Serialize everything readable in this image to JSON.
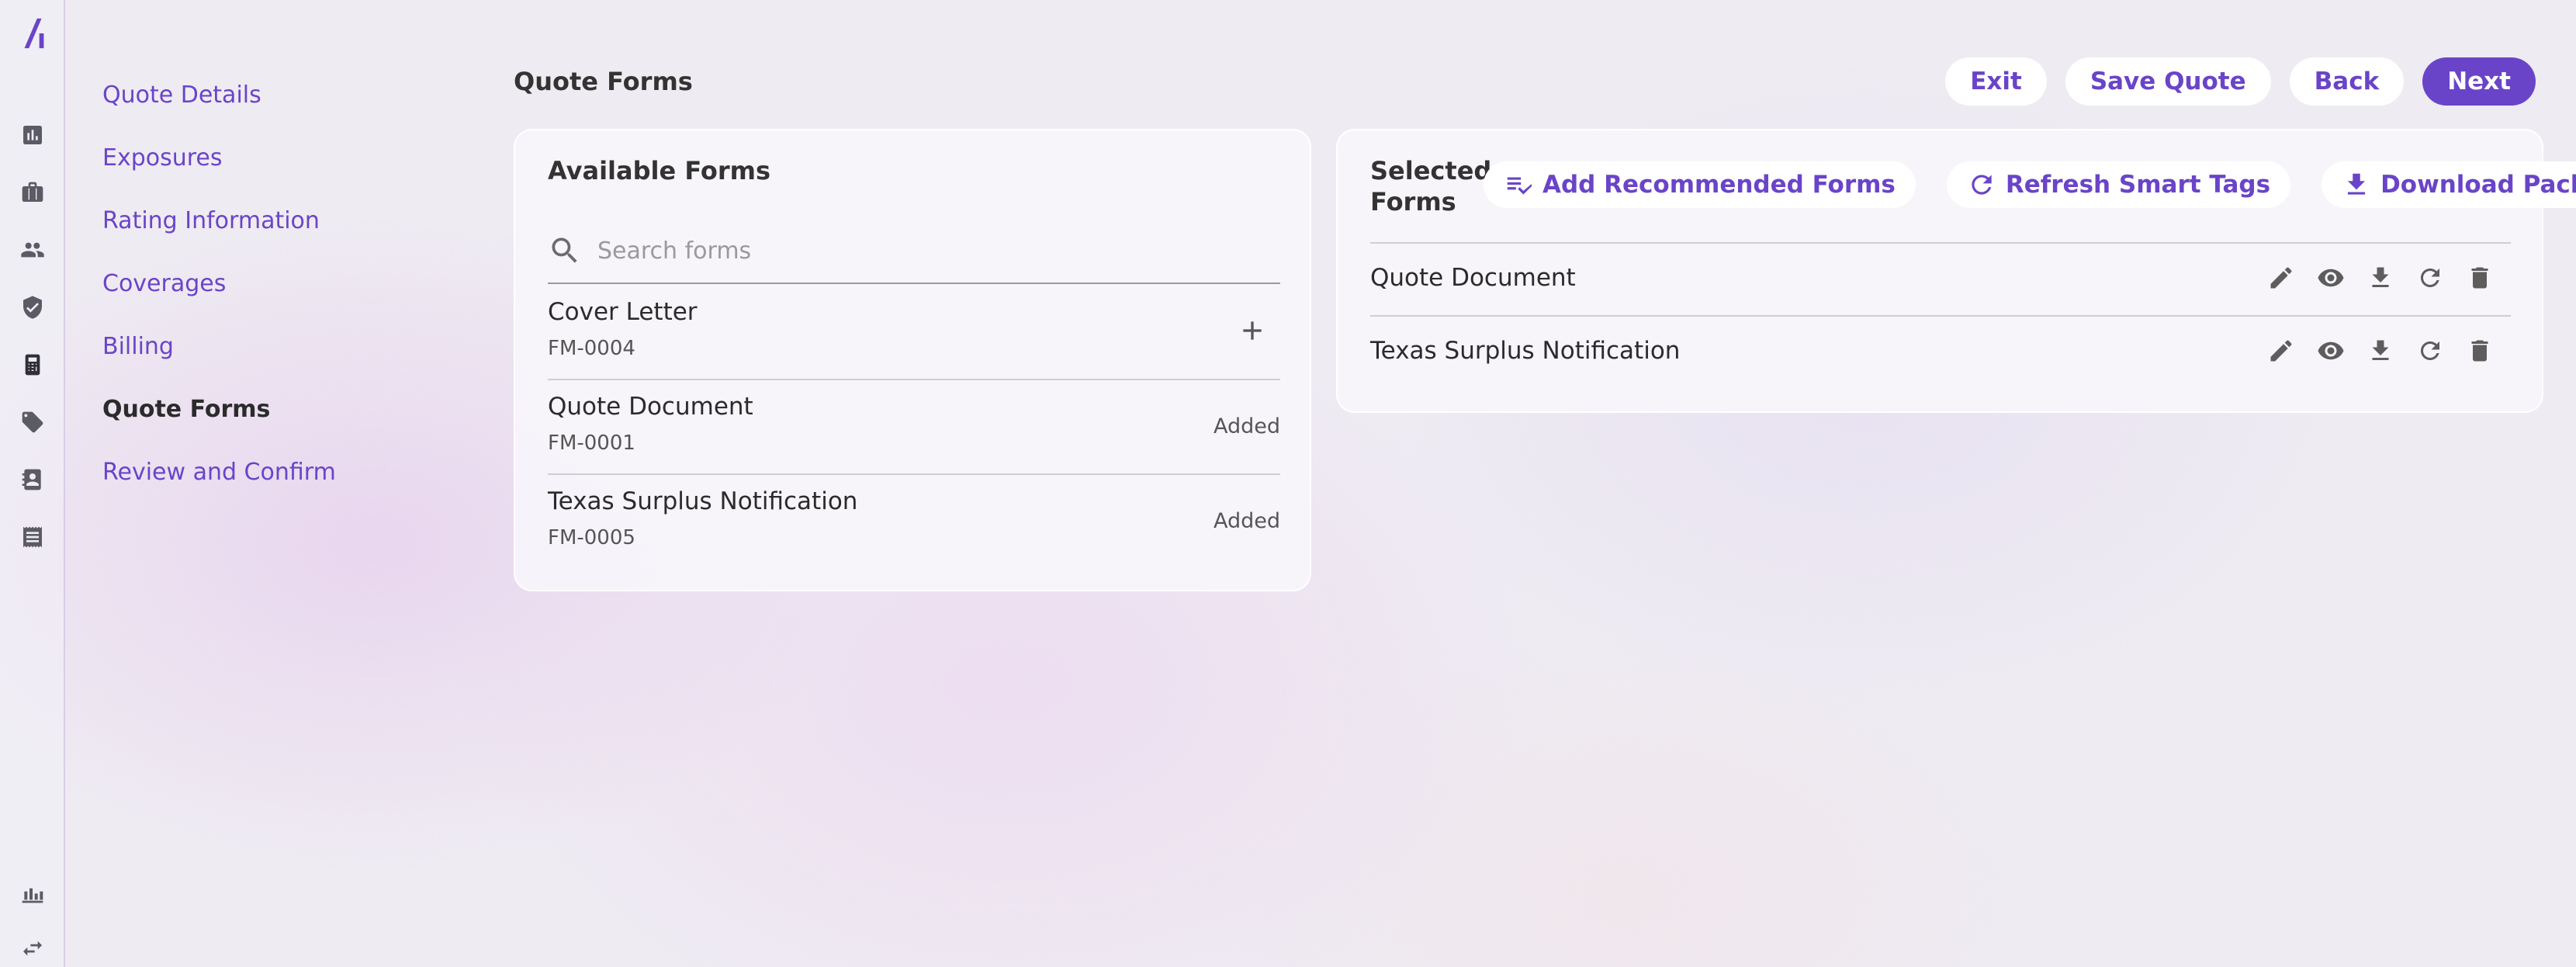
{
  "nav": {
    "steps": [
      {
        "label": "Quote Details"
      },
      {
        "label": "Exposures"
      },
      {
        "label": "Rating Information"
      },
      {
        "label": "Coverages"
      },
      {
        "label": "Billing"
      },
      {
        "label": "Quote Forms",
        "current": true
      },
      {
        "label": "Review and Confirm"
      }
    ]
  },
  "rail": {
    "logo": "brand-logo-icon",
    "icons": [
      "analytics-icon",
      "briefcase-icon",
      "people-icon",
      "shield-check-icon",
      "calculator-icon",
      "tag-icon",
      "contact-book-icon",
      "receipt-icon"
    ],
    "bottom_icons": [
      "organization-icon",
      "swap-arrows-icon"
    ]
  },
  "header": {
    "title": "Quote Forms",
    "exit_label": "Exit",
    "save_label": "Save Quote",
    "back_label": "Back",
    "next_label": "Next"
  },
  "available": {
    "title": "Available Forms",
    "search_placeholder": "Search forms",
    "forms": [
      {
        "name": "Cover Letter",
        "code": "FM-0004",
        "status": ""
      },
      {
        "name": "Quote Document",
        "code": "FM-0001",
        "status": "Added"
      },
      {
        "name": "Texas Surplus Notification",
        "code": "FM-0005",
        "status": "Added"
      }
    ]
  },
  "selected": {
    "title_line1": "Selected",
    "title_line2": "Forms",
    "add_recommended_label": "Add Recommended Forms",
    "refresh_label": "Refresh Smart Tags",
    "download_label": "Download Packet",
    "forms": [
      {
        "name": "Quote Document"
      },
      {
        "name": "Texas Surplus Notification"
      }
    ]
  },
  "colors": {
    "accent": "#6a44c8",
    "background": "#eeebf2",
    "text": "#2b2b2b"
  }
}
